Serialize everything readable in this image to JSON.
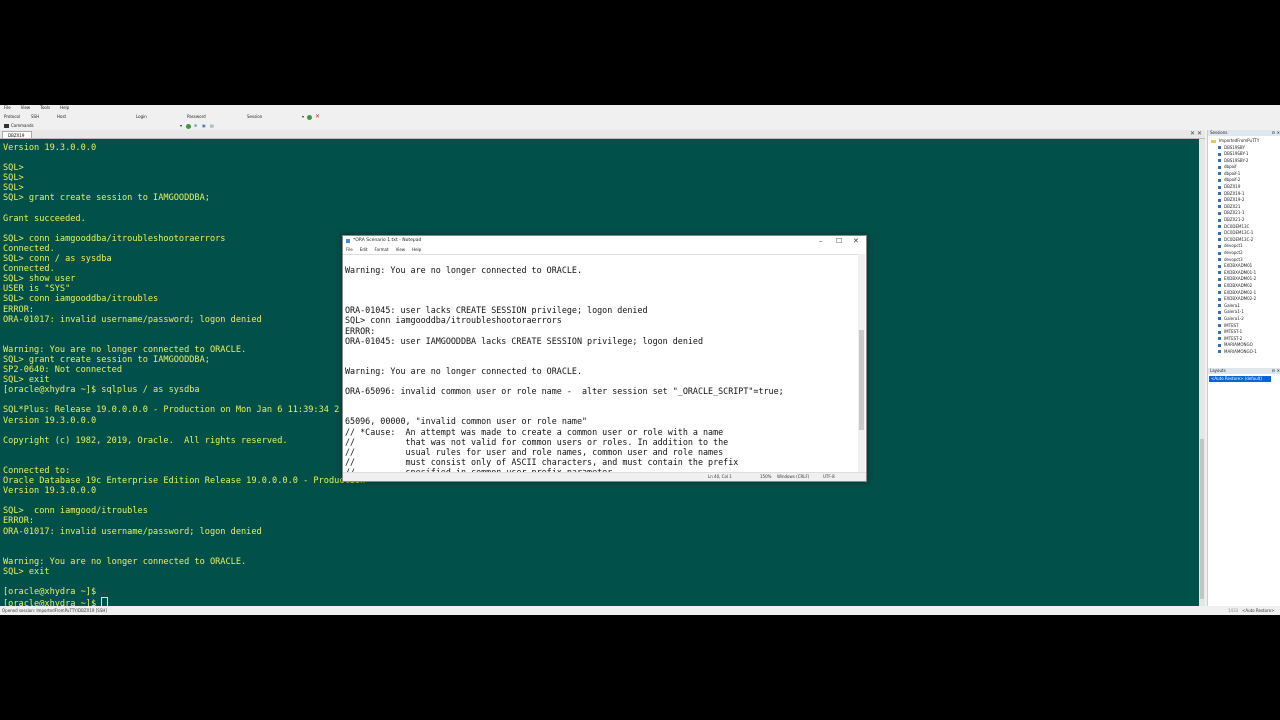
{
  "menubar": {
    "items": [
      "File",
      "View",
      "Tools",
      "Help"
    ]
  },
  "connection": {
    "protocol_label": "Protocol",
    "protocol_value": "SSH",
    "host_label": "Host",
    "login_label": "Login",
    "password_label": "Password",
    "session_label": "Session",
    "commands_label": "Commands"
  },
  "tab": {
    "label": "DBZX19"
  },
  "terminal": {
    "lines": "Version 19.3.0.0.0\n\nSQL>\nSQL>\nSQL>\nSQL> grant create session to IAMGOODDBA;\n\nGrant succeeded.\n\nSQL> conn iamgooddba/itroubleshootoraerrors\nConnected.\nSQL> conn / as sysdba\nConnected.\nSQL> show user\nUSER is \"SYS\"\nSQL> conn iamgooddba/itroubles\nERROR:\nORA-01017: invalid username/password; logon denied\n\n\nWarning: You are no longer connected to ORACLE.\nSQL> grant create session to IAMGOODDBA;\nSP2-0640: Not connected\nSQL> exit\n[oracle@xhydra ~]$ sqlplus / as sysdba\n\nSQL*Plus: Release 19.0.0.0.0 - Production on Mon Jan 6 11:39:34 2\nVersion 19.3.0.0.0\n\nCopyright (c) 1982, 2019, Oracle.  All rights reserved.\n\n\nConnected to:\nOracle Database 19c Enterprise Edition Release 19.0.0.0.0 - Production\nVersion 19.3.0.0.0\n\nSQL>  conn iamgood/itroubles\nERROR:\nORA-01017: invalid username/password; logon denied\n\n\nWarning: You are no longer connected to ORACLE.\nSQL> exit\n\n[oracle@xhydra ~]$\n[oracle@xhydra ~]$ "
  },
  "sessions": {
    "title": "Sessions",
    "root": "ImportedFromPuTTY",
    "items": [
      "DBS19SBY",
      "DBS19SBY-1",
      "DBS19SBY-2",
      "dbpoif",
      "dbpoif-1",
      "dbpoif-2",
      "DBZX19",
      "DBZX19-1",
      "DBZX19-2",
      "DBZX21",
      "DBZX21-1",
      "DBZX21-2",
      "DC0DEM13C",
      "DC0DEM13C-1",
      "DC0DEM13C-2",
      "devopct1",
      "devopct2",
      "devopct3",
      "EXDBXADM01",
      "EXDBXADM01-1",
      "EXDBXADM01-2",
      "EXDBXADM02",
      "EXDBXADM02-1",
      "EXDBXADM02-2",
      "Galera1",
      "Galera1-1",
      "Galera1-2",
      "IMTEST",
      "IMTEST-1",
      "IMTEST-2",
      "MARIAMONGO",
      "MARIAMONGO-1"
    ]
  },
  "layouts": {
    "title": "Layouts",
    "selected": "<Auto Restore> (default)"
  },
  "status": {
    "left": "Opened session: ImportedFromPuTTY/DBZX19 [SSH]",
    "right_num": "1433",
    "right_label": "<Auto Restore>"
  },
  "notepad": {
    "title": "*ORA Scenario 1.txt - Notepad",
    "menu": [
      "File",
      "Edit",
      "Format",
      "View",
      "Help"
    ],
    "text": "Warning: You are no longer connected to ORACLE.\n\n\n\nORA-01045: user lacks CREATE SESSION privilege; logon denied\nSQL> conn iamgooddba/itroubleshootoraerrors\nERROR:\nORA-01045: user IAMGOODDBA lacks CREATE SESSION privilege; logon denied\n\n\nWarning: You are no longer connected to ORACLE.\n\nORA-65096: invalid common user or role name -  alter session set \"_ORACLE_SCRIPT\"=true;\n\n\n65096, 00000, \"invalid common user or role name\"\n// *Cause:  An attempt was made to create a common user or role with a name\n//          that was not valid for common users or roles. In addition to the\n//          usual rules for user and role names, common user and role names\n//          must consist only of ASCII characters, and must contain the prefix\n//          specified in common_user_prefix parameter.",
    "status_position": "Ln 40, Col 1",
    "status_zoom": "150%",
    "status_eol": "Windows (CRLF)",
    "status_encoding": "UTF-8"
  },
  "colors": {
    "terminal_bg": "#02504a",
    "terminal_fg": "#e9f25a",
    "selection": "#0a64d6"
  }
}
